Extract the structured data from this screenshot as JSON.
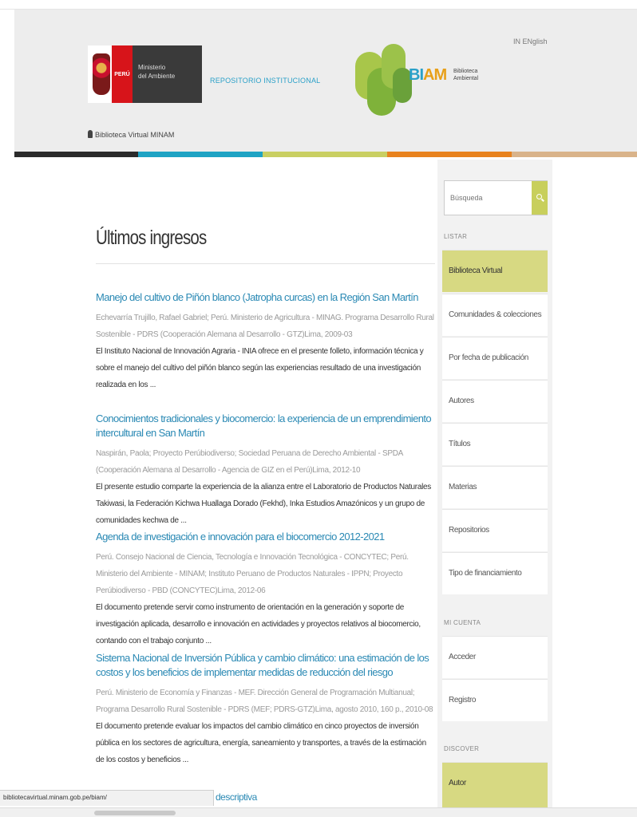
{
  "header": {
    "ministry_logo": {
      "country": "PERÚ",
      "ministry_line1": "Ministerio",
      "ministry_line2": "del Ambiente"
    },
    "repository_label": "REPOSITORIO INSTITUCIONAL",
    "virtual_library_link": "Biblioteca Virtual MINAM",
    "biam_logo": {
      "mark_bi": "BI",
      "mark_am": "AM",
      "subtitle_line1": "Biblioteca",
      "subtitle_line2": "Ambiental"
    },
    "language_link": "IN ENglish",
    "color_bar": [
      "#2b2b2b",
      "#1fa3c4",
      "#c9cf62",
      "#e8821e",
      "#d9b38a"
    ]
  },
  "main": {
    "page_title": "Últimos ingresos",
    "items": [
      {
        "title": "Manejo del cultivo de Piñón blanco (Jatropha curcas) en la Región San Martín",
        "meta": "Echevarría Trujillo, Rafael Gabriel; Perú. Ministerio de Agricultura - MINAG. Programa Desarrollo Rural Sostenible - PDRS (Cooperación Alemana al Desarrollo - GTZ)Lima, 2009-03",
        "abstract": "El Instituto Nacional de Innovación Agraria - INIA ofrece en el presente folleto, información técnica y sobre el manejo del cultivo del piñón blanco según las experiencias resultado de una investigación realizada en los ..."
      },
      {
        "title": "Conocimientos tradicionales y biocomercio: la experiencia de un emprendimiento intercultural en San Martín",
        "meta": "Naspirán, Paola; Proyecto Perúbiodiverso; Sociedad Peruana de Derecho Ambiental - SPDA (Cooperación Alemana al Desarrollo - Agencia de GIZ en el Perú)Lima, 2012-10",
        "abstract": "El presente estudio comparte la experiencia de la alianza entre el Laboratorio de Productos Naturales Takiwasi, la Federación Kichwa Huallaga Dorado (Fekhd), Inka Estudios Amazónicos y un grupo de comunidades kechwa de ..."
      },
      {
        "title": "Agenda de investigación e innovación para el biocomercio 2012-2021",
        "meta": "Perú. Consejo Nacional de Ciencia, Tecnología e Innovación Tecnológica - CONCYTEC; Perú. Ministerio del Ambiente - MINAM; Instituto Peruano de Productos Naturales - IPPN; Proyecto Perúbiodiverso - PBD (CONCYTEC)Lima, 2012-06",
        "abstract": "El documento pretende servir como instrumento de orientación en la generación y soporte de investigación aplicada, desarrollo e innovación en actividades y proyectos relativos al biocomercio, contando con el trabajo conjunto ..."
      },
      {
        "title": "Sistema Nacional de Inversión Pública y cambio climático: una estimación de los costos y los beneficios de implementar medidas de reducción del riesgo",
        "meta": "Perú. Ministerio de Economía y Finanzas - MEF. Dirección General de Programación Multianual; Programa Desarrollo Rural Sostenible - PDRS (MEF; PDRS-GTZ)Lima, agosto 2010, 160 p., 2010-08",
        "abstract": "El documento pretende evaluar los impactos del cambio climático en cinco proyectos de inversión pública en los sectores de agricultura, energía, saneamiento y transportes, a través de la estimación de los costos y beneficios ..."
      }
    ],
    "partial_next_item": "descriptiva"
  },
  "sidebar": {
    "search": {
      "placeholder": "Búsqueda"
    },
    "list_heading": "Listar",
    "list_items": [
      "Biblioteca Virtual",
      "Comunidades & colecciones",
      "Por fecha de publicación",
      "Autores",
      "Títulos",
      "Materias",
      "Repositorios",
      "Tipo de financiamiento"
    ],
    "account_heading": "Mi cuenta",
    "account_items": [
      "Acceder",
      "Registro"
    ],
    "discover_heading": "Discover",
    "discover_items": [
      "Autor"
    ]
  },
  "browser": {
    "status_url": "bibliotecavirtual.minam.gob.pe/biam/",
    "accent_color": "#d7d982",
    "link_color": "#2a89b4"
  }
}
